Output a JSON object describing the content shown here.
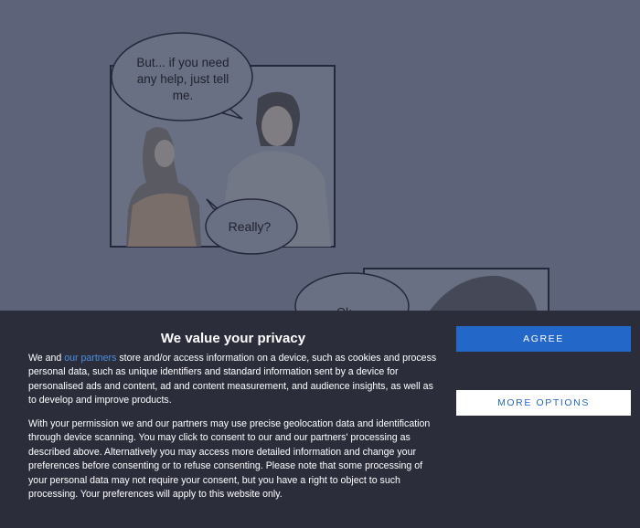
{
  "comic": {
    "bubble_top": "But... if you need any help, just tell me.",
    "bubble_top_lines": [
      "But... if you need",
      "any help, just tell",
      "me."
    ],
    "bubble_mid": "Really?",
    "bubble_bottom_partial": "Ok"
  },
  "consent": {
    "title": "We value your privacy",
    "p1_before": "We and ",
    "p1_link": "our partners",
    "p1_after": " store and/or access information on a device, such as cookies and process personal data, such as unique identifiers and standard information sent by a device for personalised ads and content, ad and content measurement, and audience insights, as well as to develop and improve products.",
    "p2": "With your permission we and our partners may use precise geolocation data and identification through device scanning. You may click to consent to our and our partners' processing as described above. Alternatively you may access more detailed information and change your preferences before consenting or to refuse consenting. Please note that some processing of your personal data may not require your consent, but you have a right to object to such processing. Your preferences will apply to this website only.",
    "agree_label": "AGREE",
    "more_options_label": "MORE OPTIONS"
  },
  "colors": {
    "banner_bg": "#2b2d3b",
    "accent": "#2367c8",
    "link": "#4d8fe0",
    "page_dim": "#5d6378"
  }
}
